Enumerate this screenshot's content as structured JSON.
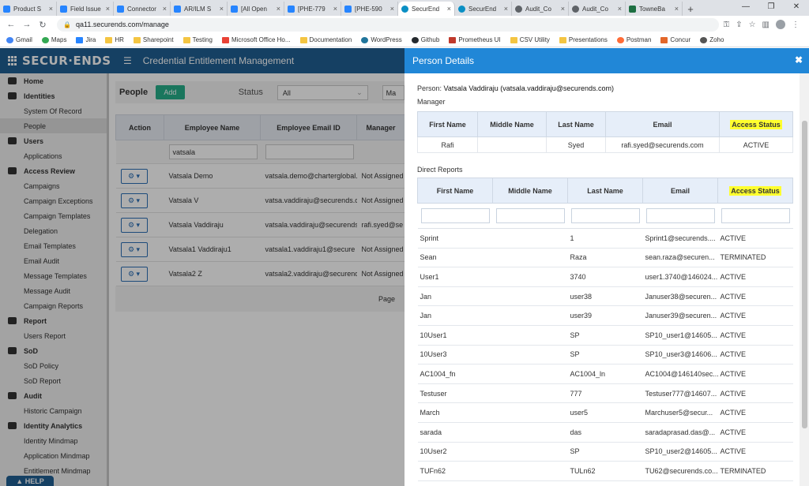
{
  "browser": {
    "tabs": [
      {
        "title": "Product S",
        "icon": "jira"
      },
      {
        "title": "Field Issue",
        "icon": "jira"
      },
      {
        "title": "Connector",
        "icon": "jira"
      },
      {
        "title": "AR/ILM S",
        "icon": "jira"
      },
      {
        "title": "[All Open",
        "icon": "jira"
      },
      {
        "title": "[PHE-779",
        "icon": "jira"
      },
      {
        "title": "[PHE-590",
        "icon": "jira"
      },
      {
        "title": "SecurEnd",
        "icon": "secur"
      },
      {
        "title": "SecurEnd",
        "icon": "secur"
      },
      {
        "title": "Audit_Co",
        "icon": "globe"
      },
      {
        "title": "Audit_Co",
        "icon": "globe"
      },
      {
        "title": "TowneBa",
        "icon": "excel"
      }
    ],
    "url": "qa11.securends.com/manage",
    "bookmarks": [
      "Gmail",
      "Maps",
      "Jira",
      "HR",
      "Sharepoint",
      "Testing",
      "Microsoft Office Ho...",
      "Documentation",
      "WordPress",
      "Github",
      "Prometheus UI",
      "CSV Utility",
      "Presentations",
      "Postman",
      "Concur",
      "Zoho"
    ]
  },
  "app": {
    "logo": "SECUR·ENDS",
    "title": "Credential Entitlement Management",
    "help": "HELP"
  },
  "sidebar": [
    {
      "label": "Home",
      "section": true
    },
    {
      "label": "Identities",
      "section": true
    },
    {
      "label": "System Of Record",
      "section": false
    },
    {
      "label": "People",
      "section": false,
      "active": true
    },
    {
      "label": "Users",
      "section": true
    },
    {
      "label": "Applications",
      "section": false
    },
    {
      "label": "Access Review",
      "section": true
    },
    {
      "label": "Campaigns",
      "section": false
    },
    {
      "label": "Campaign Exceptions",
      "section": false
    },
    {
      "label": "Campaign Templates",
      "section": false
    },
    {
      "label": "Delegation",
      "section": false
    },
    {
      "label": "Email Templates",
      "section": false
    },
    {
      "label": "Email Audit",
      "section": false
    },
    {
      "label": "Message Templates",
      "section": false
    },
    {
      "label": "Message Audit",
      "section": false
    },
    {
      "label": "Campaign Reports",
      "section": false
    },
    {
      "label": "Report",
      "section": true
    },
    {
      "label": "Users Report",
      "section": false
    },
    {
      "label": "SoD",
      "section": true
    },
    {
      "label": "SoD Policy",
      "section": false
    },
    {
      "label": "SoD Report",
      "section": false
    },
    {
      "label": "Audit",
      "section": true
    },
    {
      "label": "Historic Campaign",
      "section": false
    },
    {
      "label": "Identity Analytics",
      "section": true
    },
    {
      "label": "Identity Mindmap",
      "section": false
    },
    {
      "label": "Application Mindmap",
      "section": false
    },
    {
      "label": "Entitlement Mindmap",
      "section": false
    }
  ],
  "people": {
    "title": "People",
    "add_label": "Add",
    "status_label": "Status",
    "status_value": "All",
    "second_select": "Ma",
    "columns": [
      "Action",
      "Employee Name",
      "Employee Email ID",
      "Manager"
    ],
    "filter_name": "vatsala",
    "rows": [
      {
        "name": "Vatsala Demo",
        "email": "vatsala.demo@charterglobal.",
        "manager": "Not Assigned"
      },
      {
        "name": "Vatsala V",
        "email": "vatsa.vaddiraju@securends.co",
        "manager": "Not Assigned"
      },
      {
        "name": "Vatsala Vaddiraju",
        "email": "vatsala.vaddiraju@securends.",
        "manager": "rafi.syed@se"
      },
      {
        "name": "Vatsala1 Vaddiraju1",
        "email": "vatsala1.vaddiraju1@secure",
        "manager": "Not Assigned"
      },
      {
        "name": "Vatsala2 Z",
        "email": "vatsala2.vaddiraju@securend",
        "manager": "Not Assigned"
      }
    ],
    "page_label": "Page"
  },
  "panel": {
    "title": "Person Details",
    "person_label": "Person:",
    "person_value": "Vatsala Vaddiraju (vatsala.vaddiraju@securends.com)",
    "manager_title": "Manager",
    "manager_columns": [
      "First Name",
      "Middle Name",
      "Last Name",
      "Email",
      "Access Status"
    ],
    "manager_row": {
      "first": "Rafi",
      "middle": "",
      "last": "Syed",
      "email": "rafi.syed@securends.com",
      "status": "ACTIVE"
    },
    "reports_title": "Direct Reports",
    "reports_columns": [
      "First Name",
      "Middle Name",
      "Last Name",
      "Email",
      "Access Status"
    ],
    "reports": [
      {
        "first": "Sprint",
        "middle": "",
        "last": "1",
        "email": "Sprint1@securends....",
        "status": "ACTIVE"
      },
      {
        "first": "Sean",
        "middle": "",
        "last": "Raza",
        "email": "sean.raza@securen...",
        "status": "TERMINATED"
      },
      {
        "first": "User1",
        "middle": "",
        "last": "3740",
        "email": "user1.3740@146024...",
        "status": "ACTIVE"
      },
      {
        "first": "Jan",
        "middle": "",
        "last": "user38",
        "email": "Januser38@securen...",
        "status": "ACTIVE"
      },
      {
        "first": "Jan",
        "middle": "",
        "last": "user39",
        "email": "Januser39@securen...",
        "status": "ACTIVE"
      },
      {
        "first": "10User1",
        "middle": "",
        "last": "SP",
        "email": "SP10_user1@14605...",
        "status": "ACTIVE"
      },
      {
        "first": "10User3",
        "middle": "",
        "last": "SP",
        "email": "SP10_user3@14606...",
        "status": "ACTIVE"
      },
      {
        "first": "AC1004_fn",
        "middle": "",
        "last": "AC1004_ln",
        "email": "AC1004@146140sec...",
        "status": "ACTIVE"
      },
      {
        "first": "Testuser",
        "middle": "",
        "last": "777",
        "email": "Testuser777@14607...",
        "status": "ACTIVE"
      },
      {
        "first": "March",
        "middle": "",
        "last": "user5",
        "email": "Marchuser5@secur...",
        "status": "ACTIVE"
      },
      {
        "first": "sarada",
        "middle": "",
        "last": "das",
        "email": "saradaprasad.das@...",
        "status": "ACTIVE"
      },
      {
        "first": "10User2",
        "middle": "",
        "last": "SP",
        "email": "SP10_user2@14605...",
        "status": "ACTIVE"
      },
      {
        "first": "TUFn62",
        "middle": "",
        "last": "TULn62",
        "email": "TU62@securends.co...",
        "status": "TERMINATED"
      }
    ]
  },
  "colors": {
    "header": "#1f5f93",
    "panel_header": "#2187d7",
    "add_button": "#27ae8a",
    "highlight": "#ffff2e"
  }
}
